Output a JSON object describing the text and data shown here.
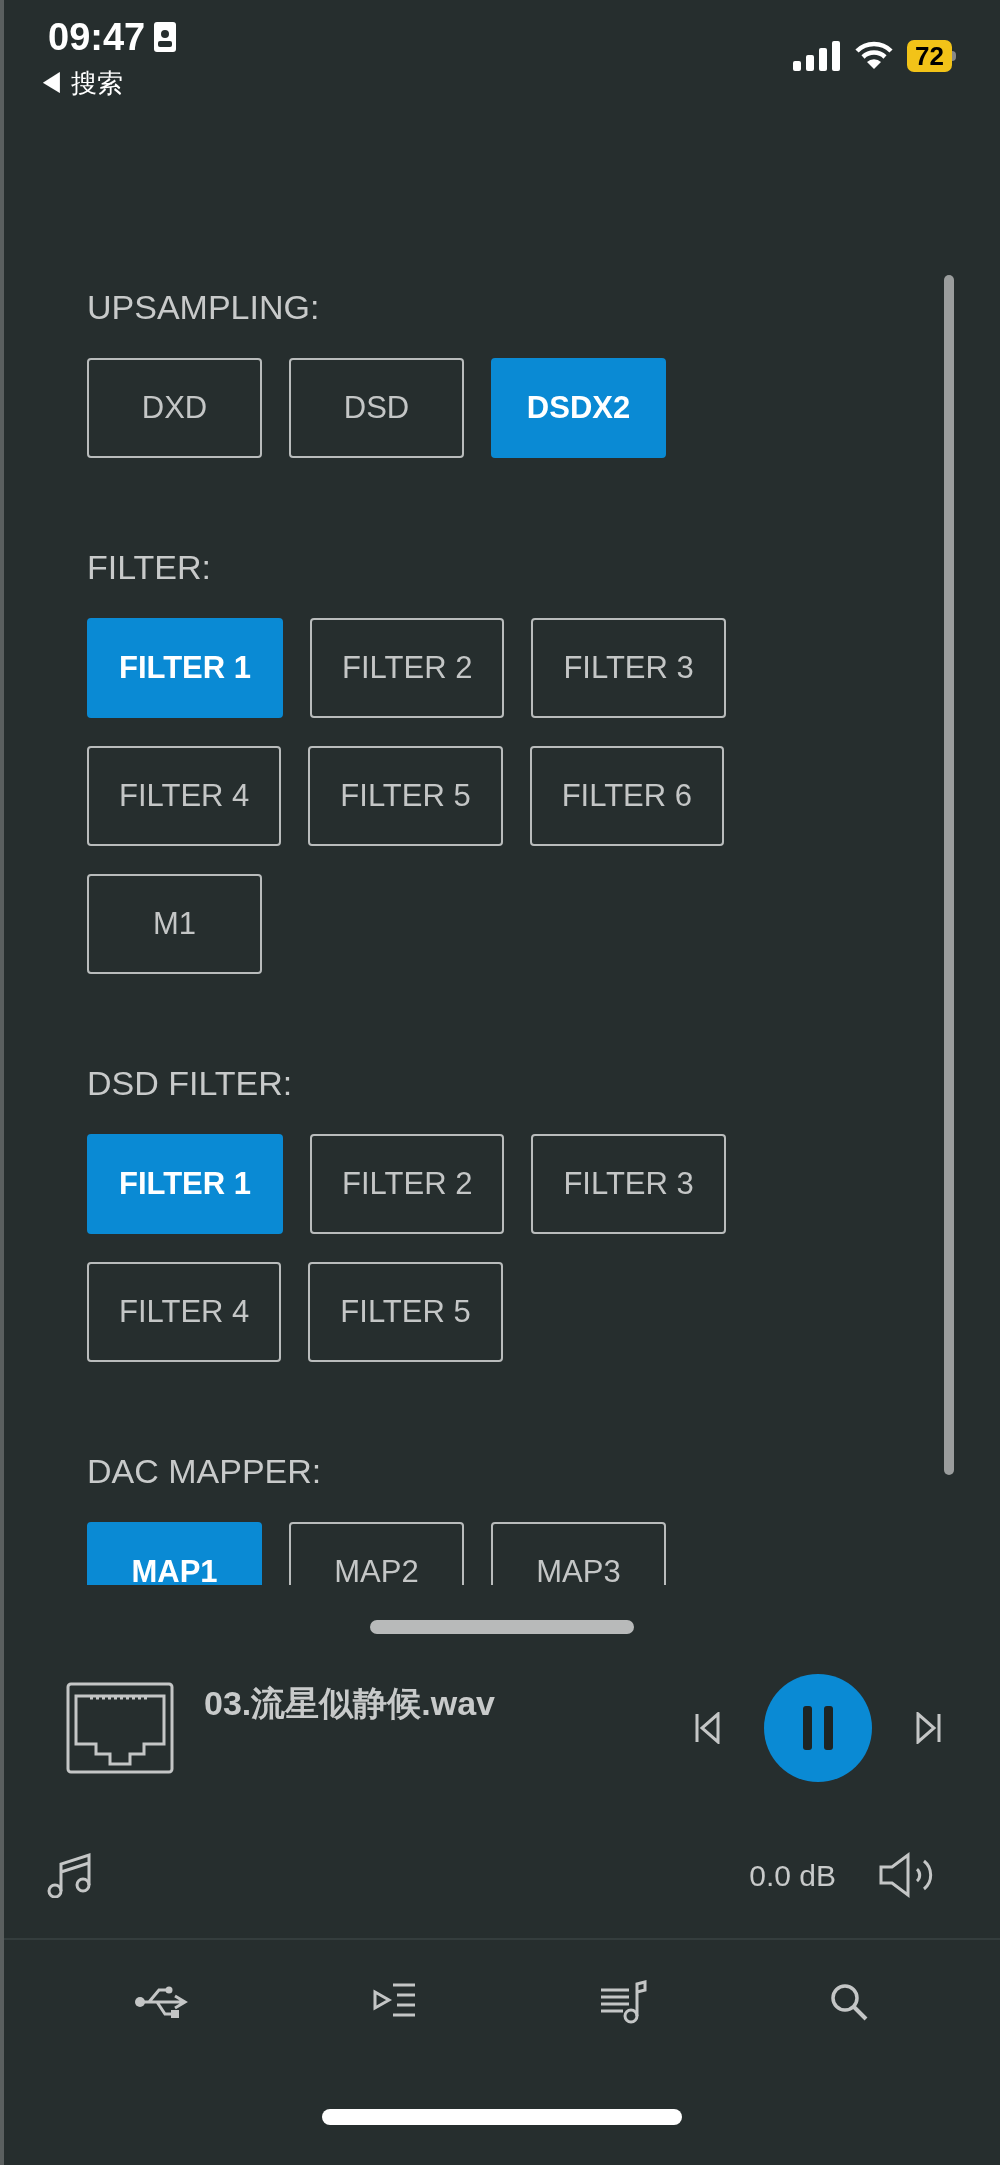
{
  "status_bar": {
    "time": "09:47",
    "back_label": "◀ 搜索",
    "battery": "72"
  },
  "sections": [
    {
      "title": "UPSAMPLING:",
      "options": [
        {
          "label": "DXD",
          "selected": false
        },
        {
          "label": "DSD",
          "selected": false
        },
        {
          "label": "DSDX2",
          "selected": true
        }
      ]
    },
    {
      "title": "FILTER:",
      "options": [
        {
          "label": "FILTER 1",
          "selected": true
        },
        {
          "label": "FILTER 2",
          "selected": false
        },
        {
          "label": "FILTER 3",
          "selected": false
        },
        {
          "label": "FILTER 4",
          "selected": false
        },
        {
          "label": "FILTER 5",
          "selected": false
        },
        {
          "label": "FILTER 6",
          "selected": false
        },
        {
          "label": "M1",
          "selected": false
        }
      ]
    },
    {
      "title": "DSD FILTER:",
      "options": [
        {
          "label": "FILTER 1",
          "selected": true
        },
        {
          "label": "FILTER 2",
          "selected": false
        },
        {
          "label": "FILTER 3",
          "selected": false
        },
        {
          "label": "FILTER 4",
          "selected": false
        },
        {
          "label": "FILTER 5",
          "selected": false
        }
      ]
    },
    {
      "title": "DAC MAPPER:",
      "options": [
        {
          "label": "MAP1",
          "selected": true
        },
        {
          "label": "MAP2",
          "selected": false
        },
        {
          "label": "MAP3",
          "selected": false
        }
      ]
    }
  ],
  "now_playing": {
    "track": "03.流星似静候.wav",
    "playing": true
  },
  "volume": {
    "reading": "0.0 dB"
  }
}
